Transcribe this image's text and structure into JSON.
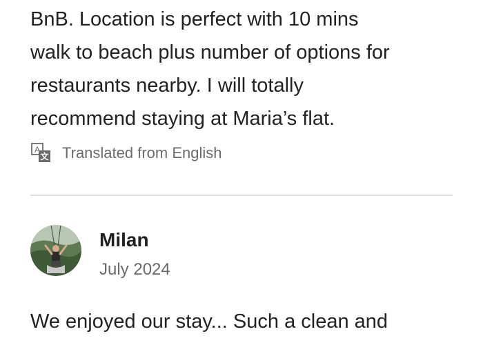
{
  "previous_review": {
    "lines": [
      "BnB. Location is perfect with 10 mins",
      "walk to beach plus number of options for",
      "restaurants nearby. I will totally",
      "recommend staying at Maria’s flat."
    ],
    "translation_note": "Translated from English",
    "translation_icon": "translate-icon"
  },
  "review": {
    "reviewer_name": "Milan",
    "date": "July 2024",
    "avatar_icon": "avatar-photo",
    "lines": [
      "We enjoyed our stay... Such a clean and"
    ]
  },
  "colors": {
    "text_primary": "#222222",
    "text_secondary": "#6a6a6a",
    "divider": "#dddddd"
  }
}
